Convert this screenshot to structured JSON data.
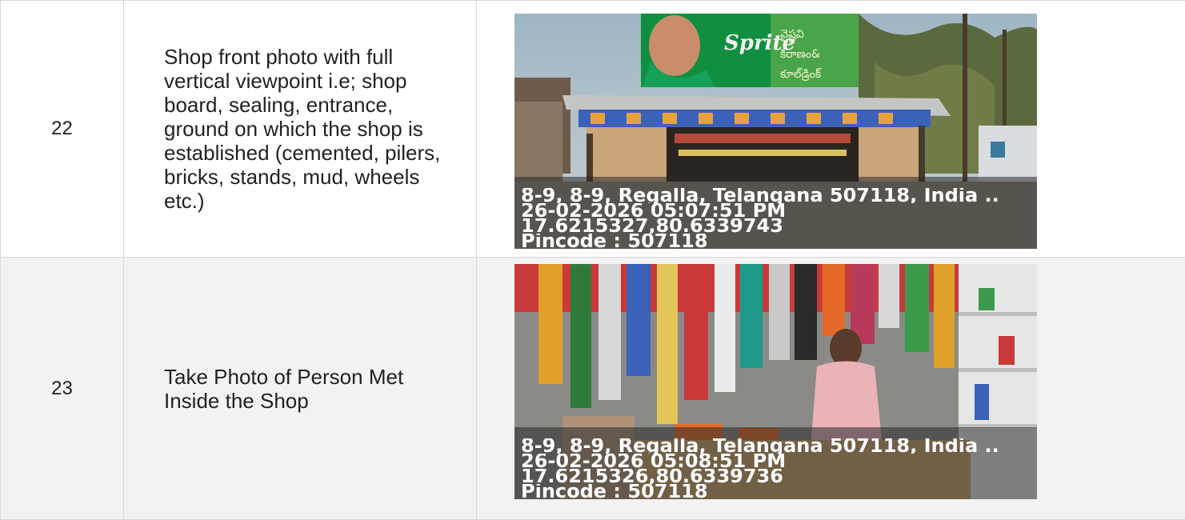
{
  "rows": [
    {
      "num": "22",
      "description": "Shop front photo with full vertical viewpoint i.e; shop board, sealing, entrance, ground on which the shop is established (cemented, pilers, bricks, stands, mud, wheels etc.)",
      "photo": {
        "address": "8-9, 8-9, Regalla, Telangana 507118, India ..",
        "datetime": "26-02-2026 05:07:51 PM",
        "coords": "17.6215327,80.6339743",
        "pincode": "Pincode : 507118",
        "sign_brand": "Sprite",
        "sign_text": [
          "వైష్ణవి",
          "కిరాణం&",
          "కూల్‌డ్రింక్"
        ]
      }
    },
    {
      "num": "23",
      "description": "Take Photo of Person Met Inside the Shop",
      "photo": {
        "address": "8-9, 8-9, Regalla, Telangana 507118, India ..",
        "datetime": "26-02-2026 05:08:51 PM",
        "coords": "17.6215326,80.6339736",
        "pincode": "Pincode : 507118"
      }
    }
  ],
  "colors": {
    "border": "#d8d8d8",
    "alt_row_bg": "#f2f2f2",
    "stamp_text": "#ffffff"
  }
}
